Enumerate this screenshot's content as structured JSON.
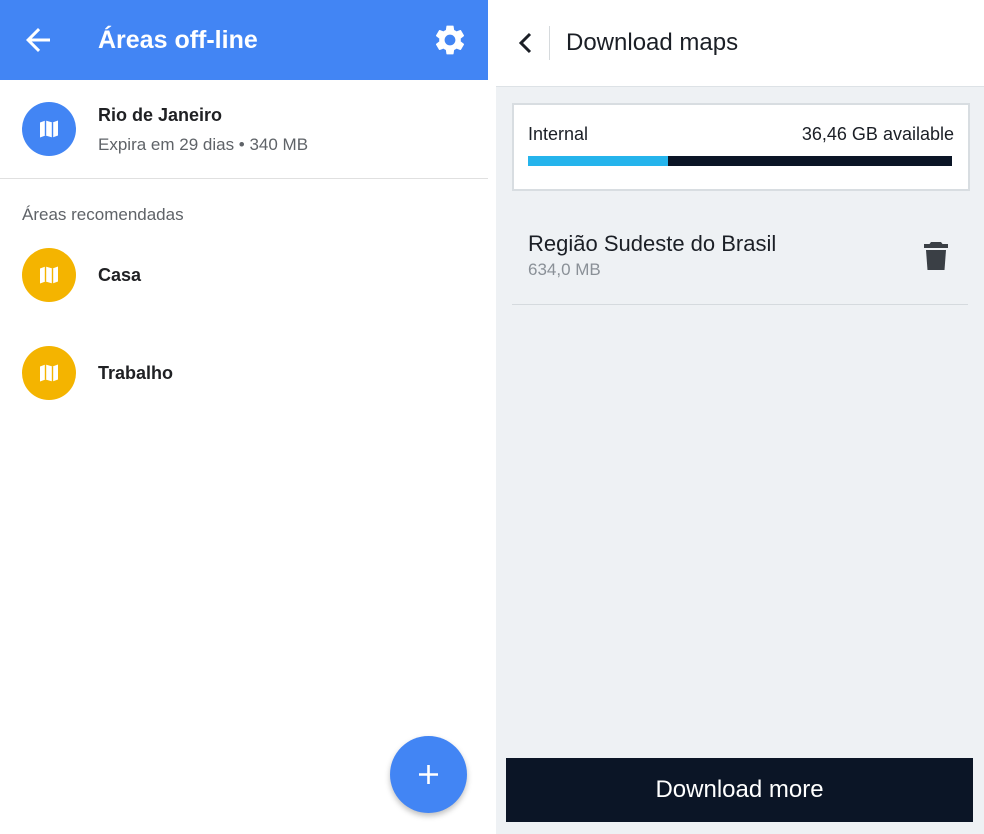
{
  "left": {
    "appbar": {
      "title": "Áreas off-line",
      "back_icon": "arrow-left-icon",
      "settings_icon": "gear-icon"
    },
    "saved_area": {
      "name": "Rio de Janeiro",
      "details": "Expira em 29 dias • 340 MB",
      "icon": "map-icon",
      "color": "#4285f4"
    },
    "section_label": "Áreas recomendadas",
    "recommended": [
      {
        "name": "Casa",
        "icon": "map-icon",
        "color": "#f4b400"
      },
      {
        "name": "Trabalho",
        "icon": "map-icon",
        "color": "#f4b400"
      }
    ],
    "fab": {
      "icon": "plus-icon",
      "color": "#4285f4"
    }
  },
  "right": {
    "header": {
      "title": "Download maps",
      "back_icon": "chevron-left-icon"
    },
    "storage": {
      "label": "Internal",
      "available": "36,46 GB available",
      "used_fraction": 0.33,
      "fill_color": "#25b4ec",
      "track_color": "#0b1526"
    },
    "maps": [
      {
        "name": "Região Sudeste do Brasil",
        "size": "634,0 MB",
        "icon": "trash-icon"
      }
    ],
    "download_button": "Download more"
  }
}
